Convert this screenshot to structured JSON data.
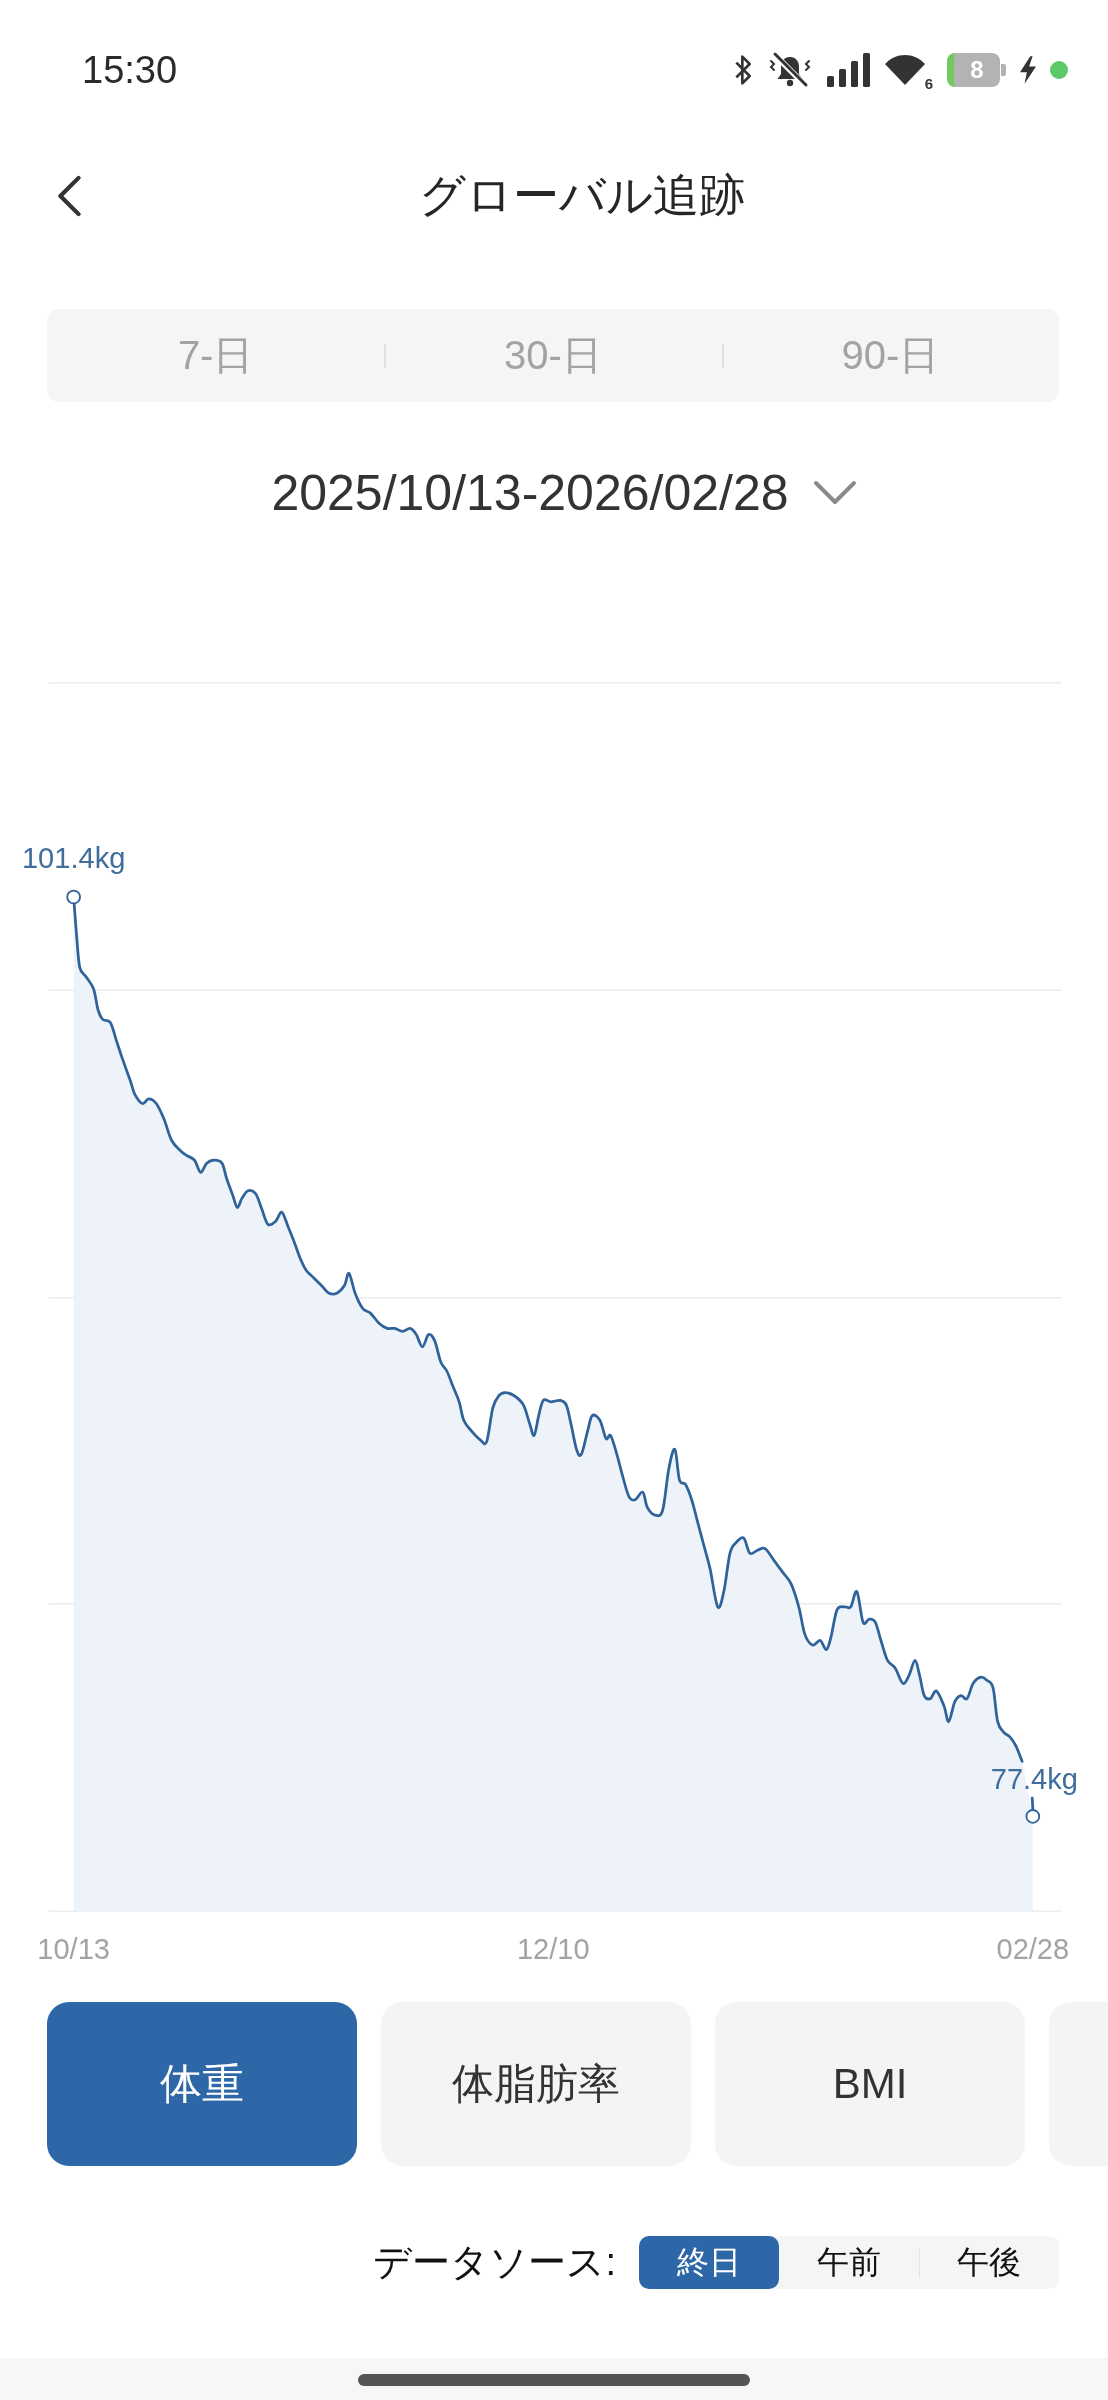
{
  "status_bar": {
    "time": "15:30",
    "wifi_badge": "6",
    "battery": "8"
  },
  "header": {
    "title": "グローバル追跡"
  },
  "ranges": [
    {
      "label": "7-日",
      "selected": false
    },
    {
      "label": "30-日",
      "selected": false
    },
    {
      "label": "90-日",
      "selected": false
    }
  ],
  "date_range": {
    "label": "2025/10/13-2026/02/28"
  },
  "chart": {
    "start_label": "101.4kg",
    "end_label": "77.4kg",
    "x_labels": [
      "10/13",
      "12/10",
      "02/28"
    ]
  },
  "metrics": [
    {
      "label": "体重",
      "selected": true
    },
    {
      "label": "体脂肪率",
      "selected": false
    },
    {
      "label": "BMI",
      "selected": false
    },
    {
      "selected": false
    }
  ],
  "data_source": {
    "label": "データソース:",
    "options": [
      {
        "label": "終日",
        "selected": true
      },
      {
        "label": "午前",
        "selected": false
      },
      {
        "label": "午後",
        "selected": false
      }
    ]
  }
}
